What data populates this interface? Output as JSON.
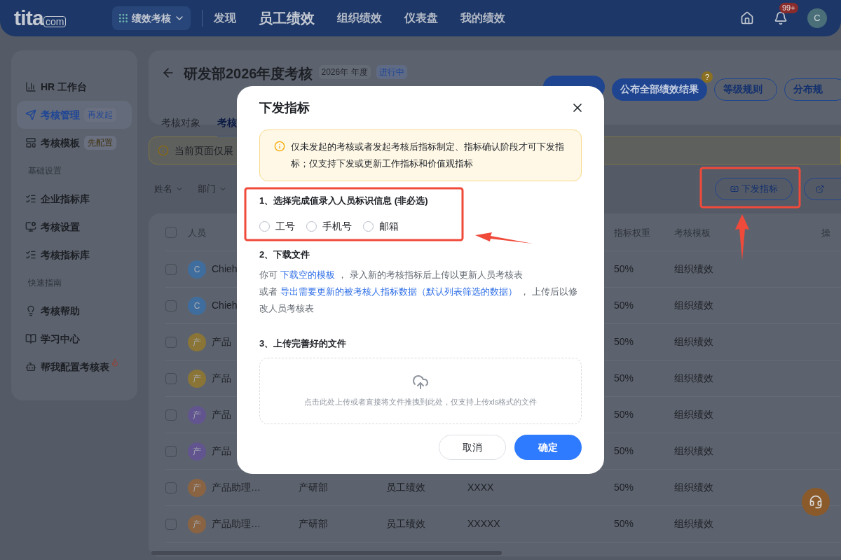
{
  "nav": {
    "logo": "tita",
    "logo_suffix": "com",
    "module": "绩效考核",
    "items": [
      {
        "label": "发现",
        "selected": false
      },
      {
        "label": "员工绩效",
        "selected": true
      },
      {
        "label": "组织绩效",
        "selected": false
      },
      {
        "label": "仪表盘",
        "selected": false
      },
      {
        "label": "我的绩效",
        "selected": false
      }
    ],
    "notification_count": "99+",
    "avatar": "C"
  },
  "sidebar": {
    "groups": [
      {
        "items": [
          {
            "label": "HR 工作台",
            "selected": false
          },
          {
            "label": "考核管理",
            "selected": true,
            "badge": {
              "text": "再发起",
              "color": "#1e4596"
            }
          },
          {
            "label": "考核模板",
            "selected": false,
            "badge": {
              "text": "先配置",
              "color": "#3f300a"
            }
          }
        ]
      },
      {
        "heading": "基础设置",
        "items": [
          {
            "label": "企业指标库",
            "selected": false
          },
          {
            "label": "考核设置",
            "selected": false
          },
          {
            "label": "考核指标库",
            "selected": false
          }
        ]
      },
      {
        "heading": "快速指南",
        "items": [
          {
            "label": "考核帮助",
            "selected": false
          },
          {
            "label": "学习中心",
            "selected": false
          },
          {
            "label": "帮我配置考核表",
            "selected": false,
            "hot": true
          }
        ]
      }
    ]
  },
  "header": {
    "title": "研发部2026年度考核",
    "period": "2026年 年度",
    "status": "进行中",
    "buttons": [
      {
        "kind": "primary"
      },
      {
        "kind": "primary",
        "label": "公布全部绩效结果",
        "help": "?"
      },
      {
        "kind": "outline",
        "label": "等级规则"
      },
      {
        "kind": "outline",
        "label": "分布规"
      }
    ],
    "tabs": [
      {
        "label": "考核对象",
        "selected": false
      },
      {
        "label": "考核",
        "selected": true
      }
    ]
  },
  "notice": "当前页面仅展",
  "filters": [
    "姓名",
    "部门"
  ],
  "toolbar": [
    {
      "label": "下发指标"
    }
  ],
  "table": {
    "all_checked": false,
    "columns": [
      "人员",
      "指标权重",
      "考核模板",
      "操"
    ],
    "rows": [
      {
        "checked": false,
        "avatar": "C",
        "color": "#3f6d9e",
        "name": "Chieh",
        "weight": "50%",
        "template": "组织绩效"
      },
      {
        "checked": false,
        "avatar": "C",
        "color": "#3f6d9e",
        "name": "Chieh",
        "weight": "50%",
        "template": "组织绩效"
      },
      {
        "checked": false,
        "avatar": "产",
        "color": "#8a7536",
        "name": "产品",
        "weight": "50%",
        "template": "组织绩效"
      },
      {
        "checked": false,
        "avatar": "产",
        "color": "#8a7536",
        "name": "产品",
        "weight": "50%",
        "template": "组织绩效"
      },
      {
        "checked": false,
        "avatar": "产",
        "color": "#62558f",
        "name": "产品",
        "weight": "50%",
        "template": "组织绩效"
      },
      {
        "checked": false,
        "avatar": "产",
        "color": "#62558f",
        "name": "产品",
        "weight": "50%",
        "template": "组织绩效"
      },
      {
        "checked": false,
        "avatar": "产",
        "color": "#8a6442",
        "name": "产品助理…",
        "dept": "产研部",
        "type": "员工绩效",
        "indicator": "XXXX",
        "weight": "50%",
        "template": "组织绩效"
      },
      {
        "checked": false,
        "avatar": "产",
        "color": "#8a6442",
        "name": "产品助理…",
        "dept": "产研部",
        "type": "员工绩效",
        "indicator": "XXXXX",
        "weight": "50%",
        "template": "组织绩效"
      }
    ]
  },
  "dialog": {
    "title": "下发指标",
    "notice": "仅未发起的考核或者发起考核后指标制定、指标确认阶段才可下发指标；仅支持下发或更新工作指标和价值观指标",
    "step1": {
      "title": "1、选择完成值录入人员标识信息 (非必选)",
      "options": [
        {
          "label": "工号",
          "selected": false
        },
        {
          "label": "手机号",
          "selected": false
        },
        {
          "label": "邮箱",
          "selected": false
        }
      ]
    },
    "step2": {
      "title": "2、下载文件",
      "lines": [
        [
          {
            "kind": "text",
            "text": "你可"
          },
          {
            "kind": "link",
            "text": "下载空的模板"
          },
          {
            "kind": "text",
            "text": "， 录入新的考核指标后上传以更新人员考核表"
          }
        ],
        [
          {
            "kind": "text",
            "text": "或者"
          },
          {
            "kind": "link",
            "text": "导出需要更新的被考核人指标数据（默认列表筛选的数据）"
          },
          {
            "kind": "text",
            "text": "， 上传后以修改人员考核表"
          }
        ]
      ]
    },
    "step3": {
      "title": "3、上传完善好的文件",
      "hint": "点击此处上传或者直接将文件推拽到此处，仅支持上传xls格式的文件"
    },
    "buttons": [
      {
        "kind": "secondary",
        "label": "取消"
      },
      {
        "kind": "primary",
        "label": "确定"
      }
    ]
  }
}
